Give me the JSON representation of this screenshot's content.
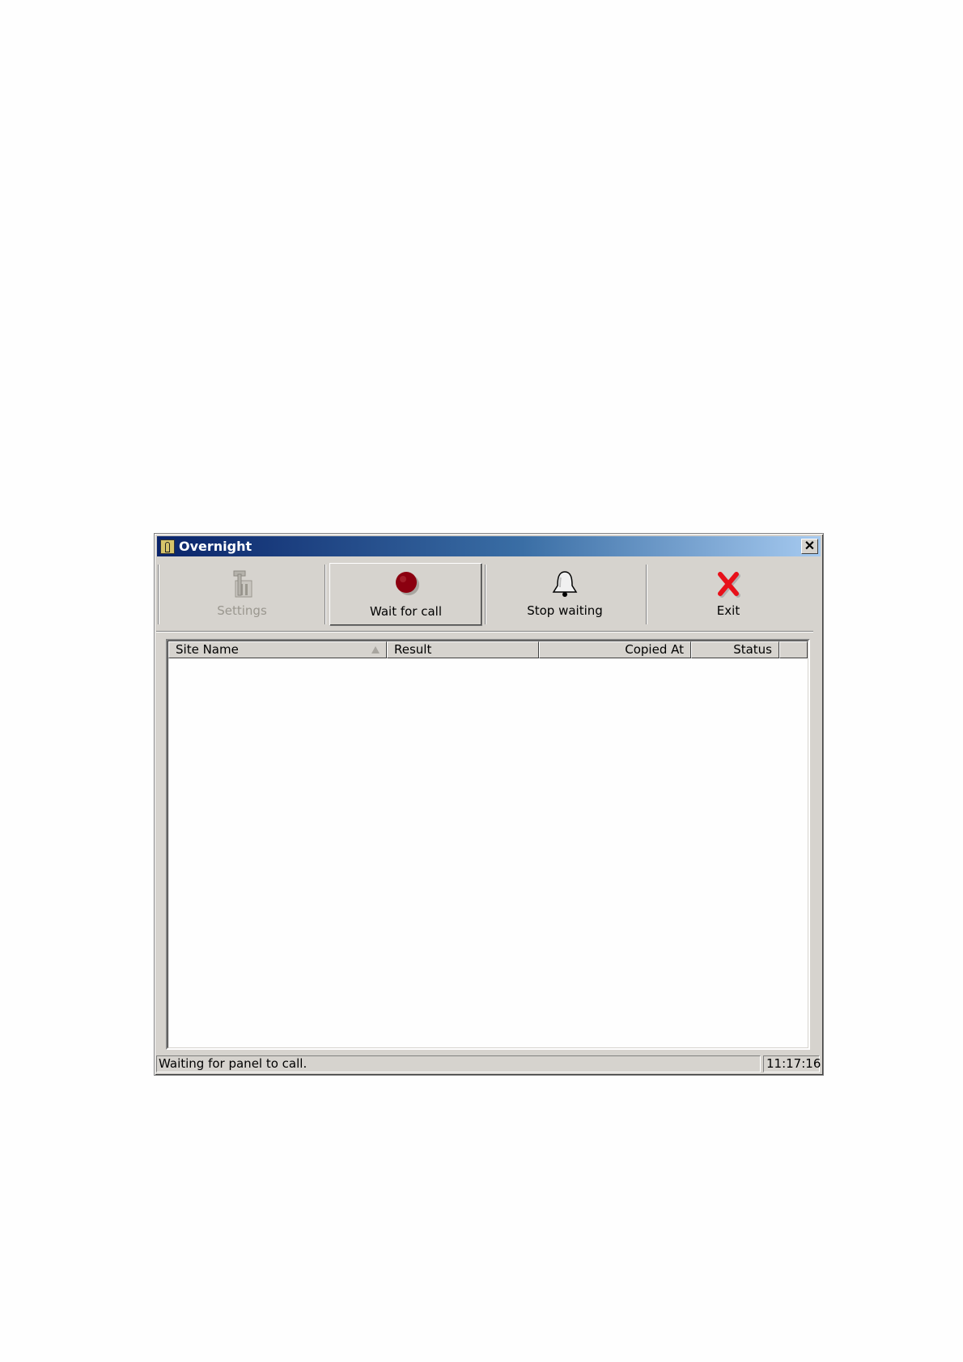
{
  "window": {
    "title": "Overnight",
    "close_glyph": "✕"
  },
  "toolbar": {
    "buttons": [
      {
        "label": "Settings",
        "icon": "settings-tools-icon",
        "enabled": false
      },
      {
        "label": "Wait for call",
        "icon": "red-record-icon",
        "enabled": true,
        "pressed": true
      },
      {
        "label": "Stop waiting",
        "icon": "bell-icon",
        "enabled": true
      },
      {
        "label": "Exit",
        "icon": "red-x-icon",
        "enabled": true
      }
    ]
  },
  "list": {
    "columns": [
      {
        "label": "Site Name",
        "sorted": "ascending"
      },
      {
        "label": "Result"
      },
      {
        "label": "Copied At"
      },
      {
        "label": "Status"
      }
    ],
    "rows": []
  },
  "status_bar": {
    "message": "Waiting for panel to call.",
    "time": "11:17:16"
  },
  "colors": {
    "title_gradient_start": "#0a246a",
    "title_gradient_end": "#a6caf0",
    "window_face": "#d6d3ce"
  }
}
